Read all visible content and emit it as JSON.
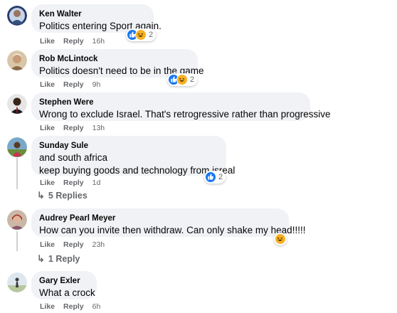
{
  "comments": [
    {
      "name": "Ken Walter",
      "text": "Politics entering Sport again.",
      "like": "Like",
      "reply": "Reply",
      "time": "16h",
      "reaction_count": "2",
      "reactions": [
        "like-icon",
        "haha-icon"
      ]
    },
    {
      "name": "Rob McLintock",
      "text": "Politics doesn't need to be in the game",
      "like": "Like",
      "reply": "Reply",
      "time": "9h",
      "reaction_count": "2",
      "reactions": [
        "like-icon",
        "haha-icon"
      ]
    },
    {
      "name": "Stephen Were",
      "text": "Wrong to exclude Israel. That's retrogressive rather than progressive",
      "like": "Like",
      "reply": "Reply",
      "time": "13h"
    },
    {
      "name": "Sunday Sule",
      "text_line1": "and south africa",
      "text_line2": "keep buying goods and technology from isreal",
      "like": "Like",
      "reply": "Reply",
      "time": "1d",
      "reaction_count": "2",
      "reactions": [
        "like-icon"
      ],
      "replies_label": "5 Replies"
    },
    {
      "name": "Audrey Pearl Meyer",
      "text": "How can you invite then withdraw. Can only shake my head!!!!!",
      "like": "Like",
      "reply": "Reply",
      "time": "23h",
      "reactions": [
        "haha-icon"
      ],
      "replies_label": "1 Reply"
    },
    {
      "name": "Gary Exler",
      "text": "What a crock",
      "like": "Like",
      "reply": "Reply",
      "time": "6h"
    }
  ],
  "colors": {
    "bubble": "#f0f2f5",
    "meta": "#65676b",
    "like_blue": "#1877f2",
    "haha_yellow": "#f7b125",
    "thread": "#ced0d4"
  }
}
